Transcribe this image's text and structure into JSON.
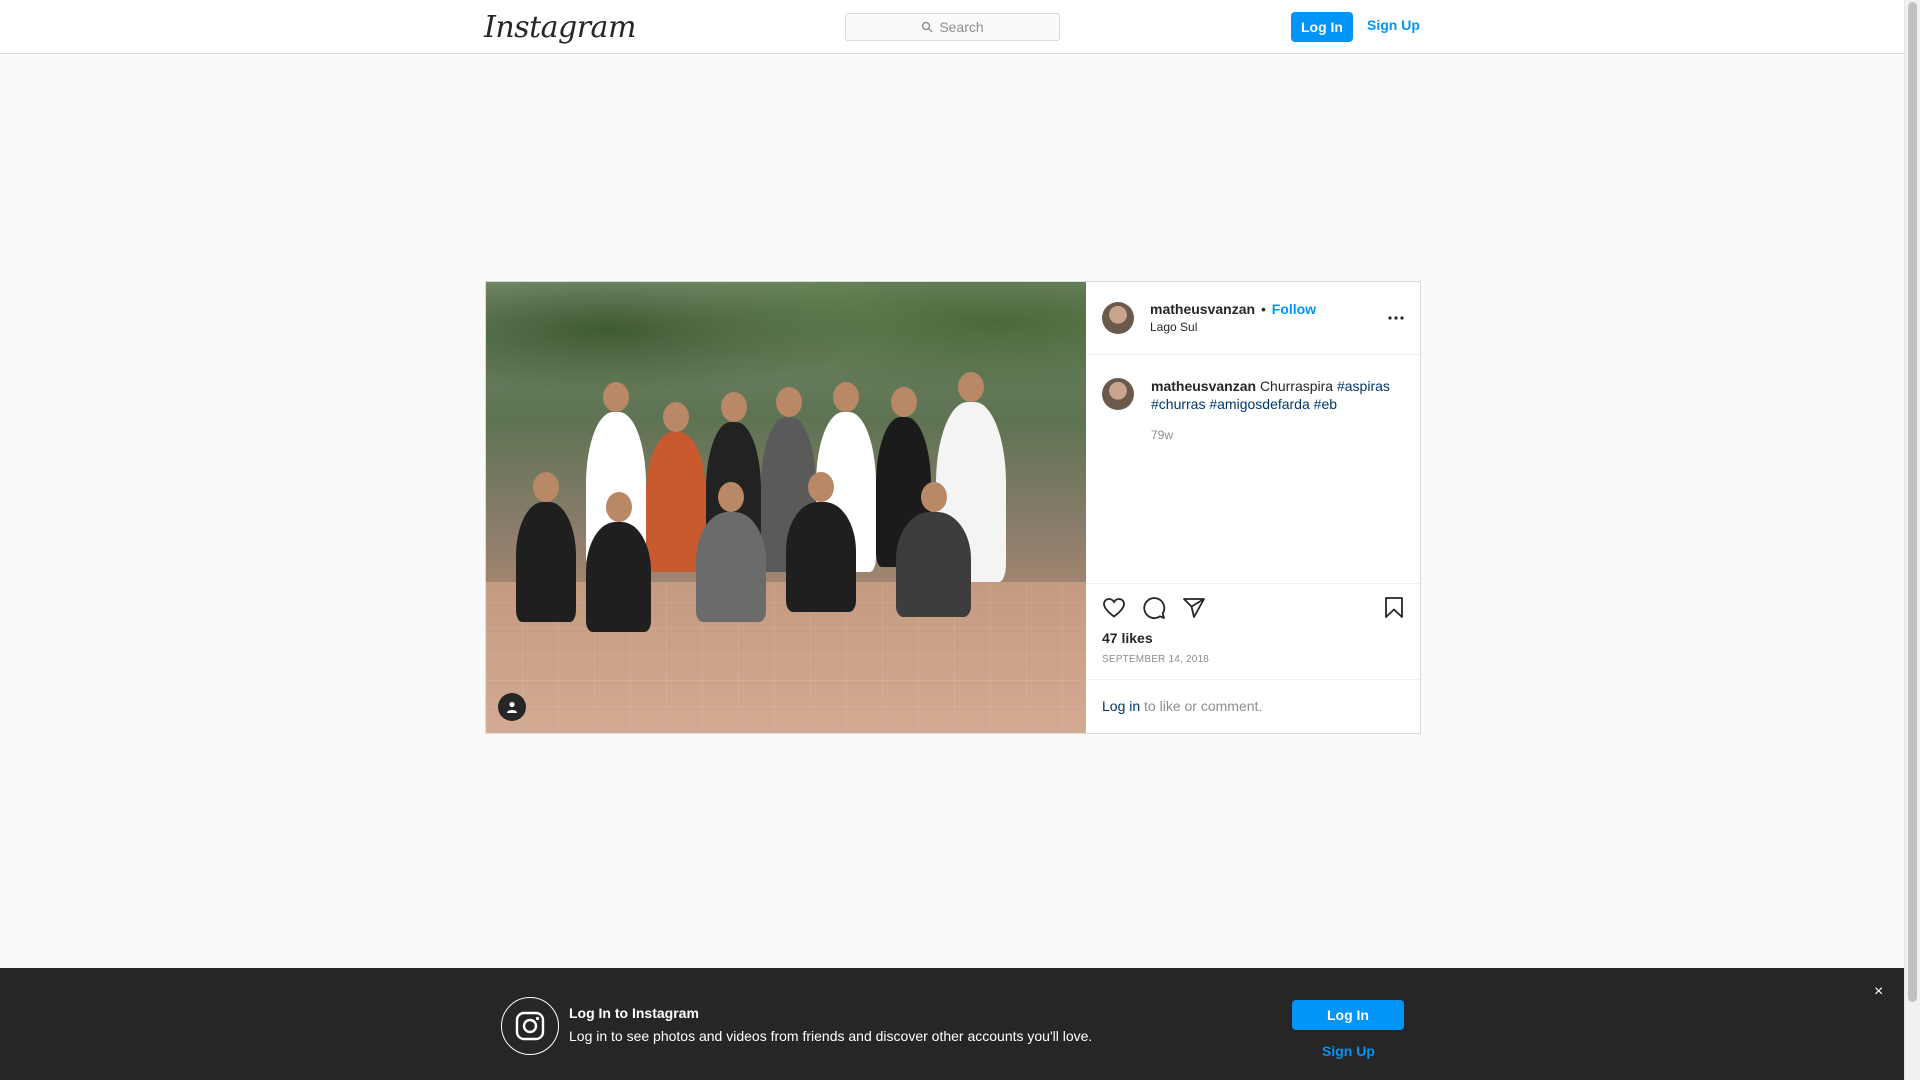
{
  "header": {
    "logo": "Instagram",
    "search_placeholder": "Search",
    "login_label": "Log In",
    "signup_label": "Sign Up"
  },
  "post": {
    "username": "matheusvanzan",
    "separator": "•",
    "follow_label": "Follow",
    "location": "Lago Sul",
    "caption_text": "Churraspira",
    "hashtags": [
      "#aspiras",
      "#churras",
      "#amigosdefarda",
      "#eb"
    ],
    "relative_time": "79w",
    "likes": "47 likes",
    "date": "SEPTEMBER 14, 2018",
    "comment_prompt_link": "Log in",
    "comment_prompt_rest": " to like or comment."
  },
  "banner": {
    "title": "Log In to Instagram",
    "text": "Log in to see photos and videos from friends and discover other accounts you'll love.",
    "login_label": "Log In",
    "signup_label": "Sign Up",
    "close_symbol": "×"
  },
  "colors": {
    "accent": "#0095f6",
    "hashtag": "#00376b",
    "banner_bg": "#262626"
  },
  "icons": [
    "search-icon",
    "more-options-icon",
    "heart-icon",
    "comment-icon",
    "share-icon",
    "bookmark-icon",
    "tagged-user-icon",
    "instagram-camera-icon",
    "close-icon"
  ]
}
